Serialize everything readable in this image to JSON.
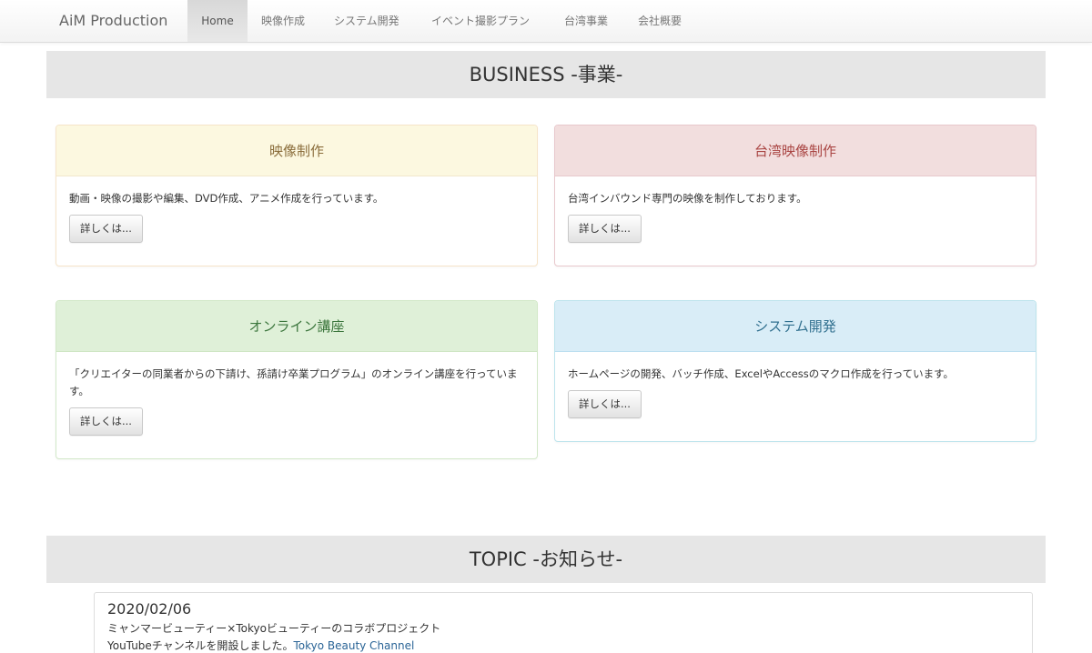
{
  "nav": {
    "brand": "AiM Production",
    "items": [
      "Home",
      "映像作成",
      "システム開発",
      "イベント撮影プラン",
      "台湾事業",
      "会社概要"
    ]
  },
  "business": {
    "title": "BUSINESS -事業-",
    "panels": [
      {
        "heading": "映像制作",
        "text": "動画・映像の撮影や編集、DVD作成、アニメ作成を行っています。",
        "button": "詳しくは..."
      },
      {
        "heading": "台湾映像制作",
        "text": "台湾インバウンド専門の映像を制作しております。",
        "button": "詳しくは..."
      },
      {
        "heading": "オンライン講座",
        "text": "「クリエイターの同業者からの下請け、孫請け卒業プログラム」のオンライン講座を行っています。",
        "button": "詳しくは..."
      },
      {
        "heading": "システム開発",
        "text": "ホームページの開発、バッチ作成、ExcelやAccessのマクロ作成を行っています。",
        "button": "詳しくは..."
      }
    ]
  },
  "topic": {
    "title": "TOPIC -お知らせ-",
    "date": "2020/02/06",
    "line1": "ミャンマービューティー×Tokyoビューティーのコラボプロジェクト",
    "line2_prefix": "YouTubeチャンネルを開設しました。",
    "link": "Tokyo Beauty Channel"
  }
}
